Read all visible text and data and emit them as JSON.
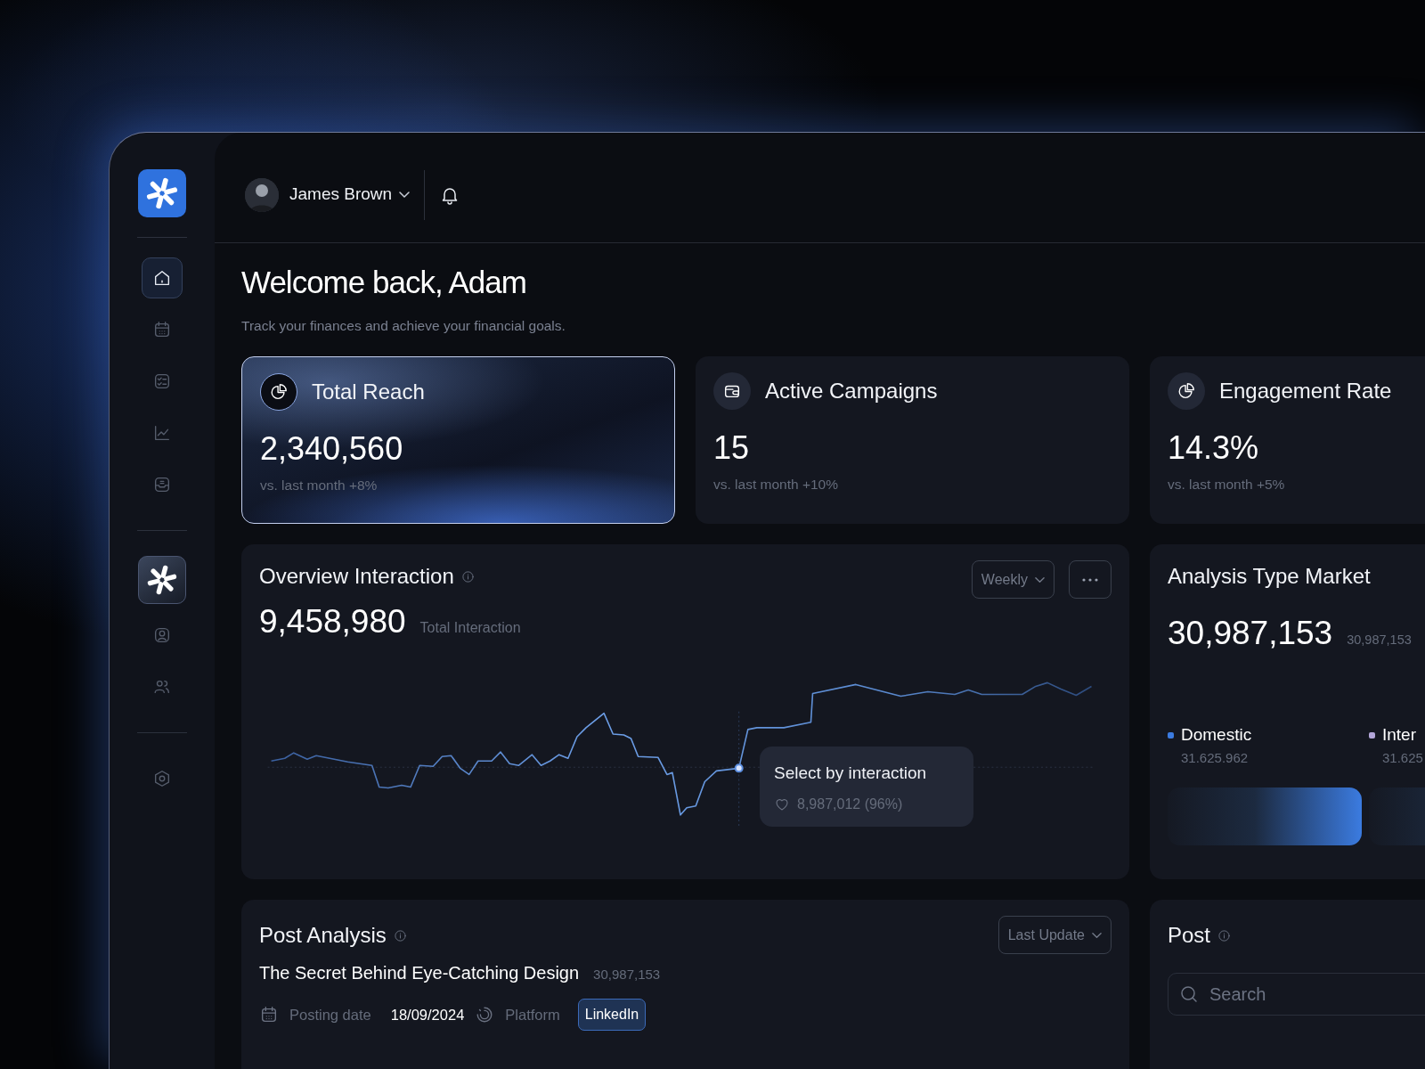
{
  "sidebar": {
    "groups": [
      [
        {
          "kind": "link",
          "selected": true
        },
        {
          "kind": "link",
          "selected": false
        },
        {
          "kind": "link",
          "selected": false
        },
        {
          "kind": "link",
          "selected": false
        },
        {
          "kind": "link",
          "selected": false
        }
      ],
      [
        {
          "kind": "workspace",
          "selected": false
        },
        {
          "kind": "link",
          "selected": false
        },
        {
          "kind": "link",
          "selected": false
        }
      ],
      [
        {
          "kind": "link",
          "selected": false
        }
      ]
    ]
  },
  "header": {
    "user_name": "James Brown"
  },
  "welcome": {
    "title": "Welcome back, Adam",
    "subtitle": "Track your finances and achieve your financial goals."
  },
  "stats": [
    {
      "label": "Total Reach",
      "value": "2,340,560",
      "change": "vs. last month +8%",
      "selected": true
    },
    {
      "label": "Active Campaigns",
      "value": "15",
      "change": "vs. last month +10%",
      "selected": false
    },
    {
      "label": "Engagement Rate",
      "value": "14.3%",
      "change": "vs. last month +5%",
      "selected": false
    }
  ],
  "overview": {
    "title": "Overview Interaction",
    "period": "Weekly",
    "total": "9,458,980",
    "total_label": "Total Interaction",
    "tooltip": {
      "title": "Select by interaction",
      "value": "8,987,012 (96%)"
    }
  },
  "market": {
    "title": "Analysis Type Market",
    "total": "30,987,153",
    "total_note": "30,987,153",
    "segments": [
      {
        "name": "Domestic",
        "value": "31.625.962",
        "color": "#3b7be0"
      },
      {
        "name": "Inter",
        "value": "31.625",
        "color": "#b3a6d9"
      }
    ]
  },
  "post_analysis": {
    "title": "Post Analysis",
    "sort": "Last Update",
    "post": {
      "title": "The Secret Behind Eye-Catching Design",
      "count": "30,987,153",
      "date_label": "Posting date",
      "date": "18/09/2024",
      "platform_label": "Platform",
      "platform": "LinkedIn"
    }
  },
  "post": {
    "title": "Post",
    "search": {
      "placeholder": "Search"
    }
  }
}
